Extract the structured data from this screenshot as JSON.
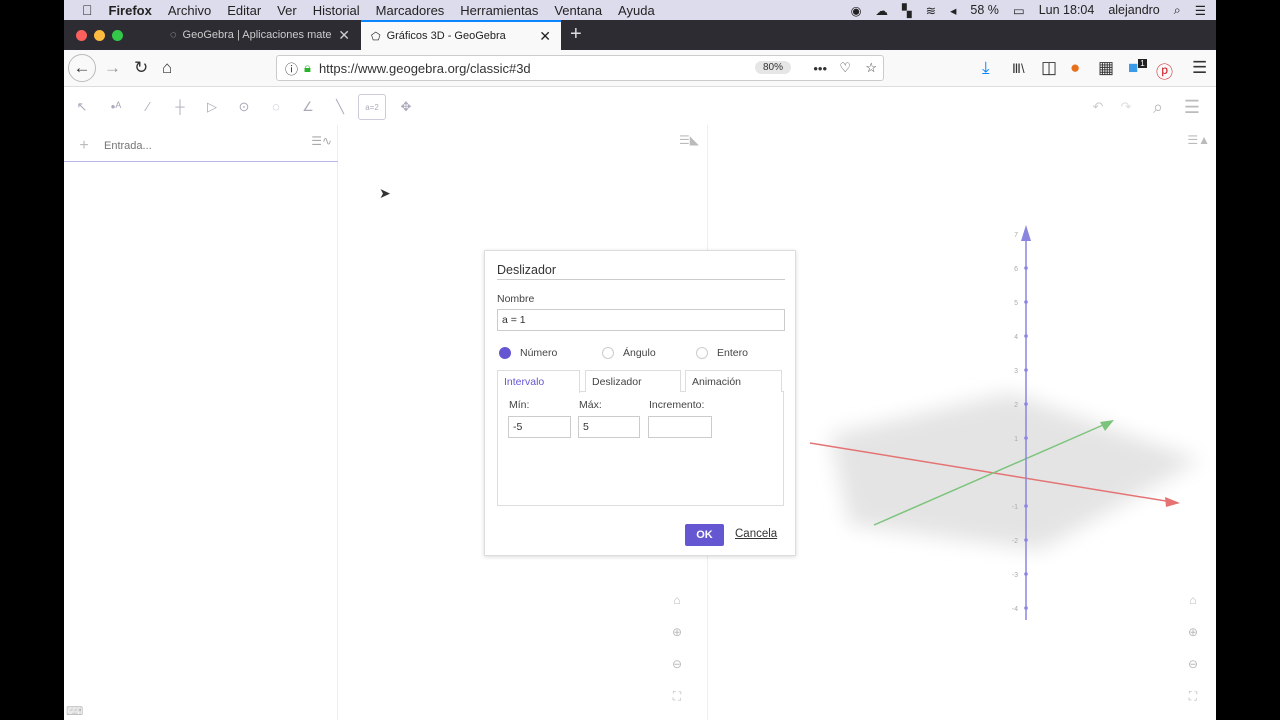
{
  "menubar": {
    "app": "Firefox",
    "items": [
      "Archivo",
      "Editar",
      "Ver",
      "Historial",
      "Marcadores",
      "Herramientas",
      "Ventana",
      "Ayuda"
    ],
    "battery": "58 %",
    "clock": "Lun 18:04",
    "user": "alejandro"
  },
  "tabs": [
    {
      "title": "GeoGebra | Aplicaciones mate"
    },
    {
      "title": "Gráficos 3D - GeoGebra"
    }
  ],
  "navbar": {
    "url": "https://www.geogebra.org/classic#3d",
    "zoom": "80%",
    "notification_count": "1"
  },
  "algebra": {
    "input_placeholder": "Entrada..."
  },
  "dialog": {
    "title": "Deslizador",
    "name_label": "Nombre",
    "name_value": "a = 1",
    "types": [
      {
        "label": "Número",
        "selected": true
      },
      {
        "label": "Ángulo",
        "selected": false
      },
      {
        "label": "Entero",
        "selected": false
      }
    ],
    "tabs": [
      "Intervalo",
      "Deslizador",
      "Animación"
    ],
    "min_label": "Mín:",
    "min_value": "-5",
    "max_label": "Máx:",
    "max_value": "5",
    "inc_label": "Incremento:",
    "inc_value": "",
    "ok": "OK",
    "cancel": "Cancela"
  },
  "graphics3d": {
    "z_ticks": [
      "7",
      "6",
      "5",
      "4",
      "3",
      "2",
      "1",
      "-1",
      "-2",
      "-3",
      "-4"
    ],
    "colors": {
      "x": "#e57373",
      "y": "#7cc47c",
      "z": "#8a86e0"
    }
  },
  "colors": {
    "accent": "#6557d2"
  }
}
